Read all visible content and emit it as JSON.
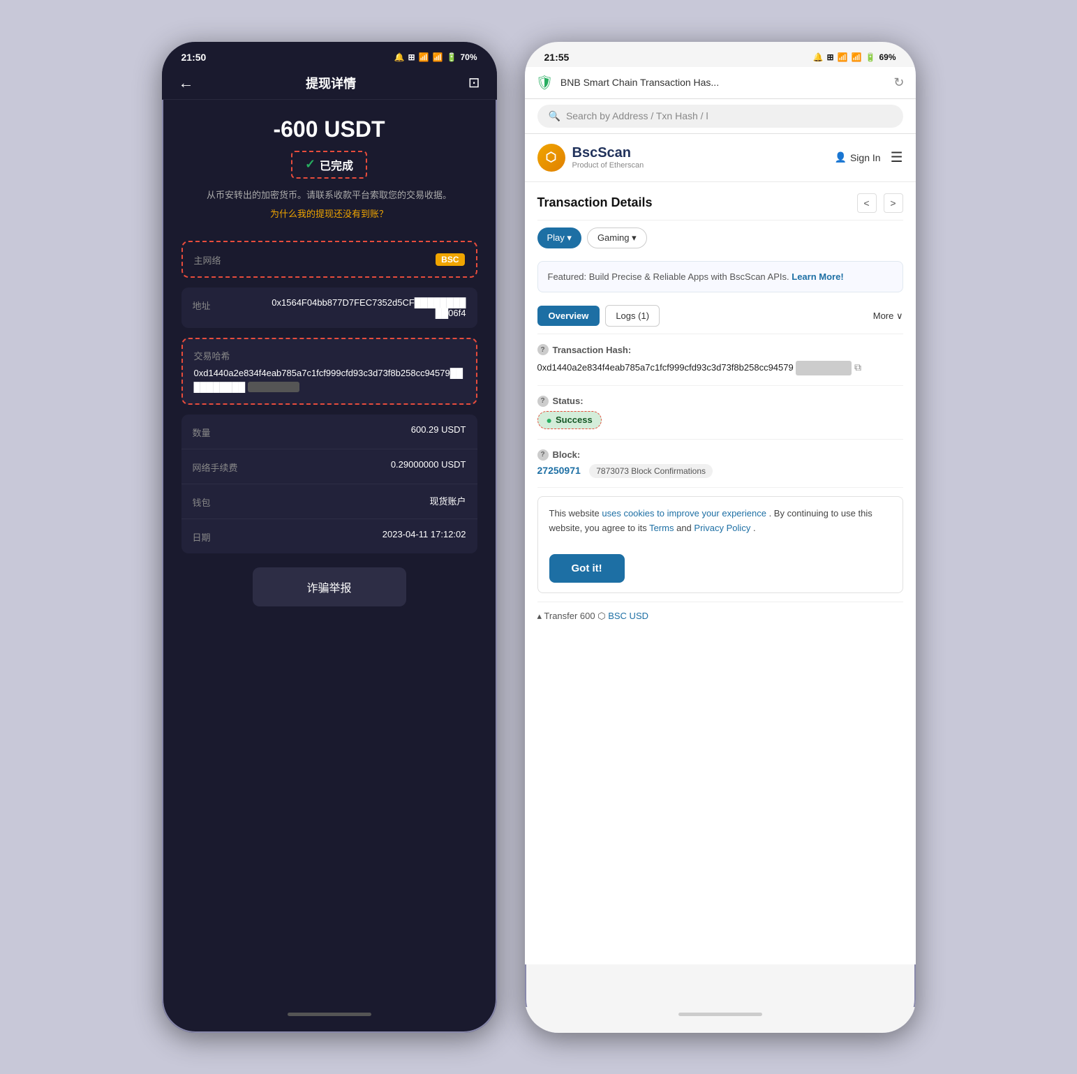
{
  "left_phone": {
    "status_bar": {
      "time": "21:50",
      "icons": "🔔 🎧 📷 📶 📶 🔋70%"
    },
    "nav": {
      "title": "提现详情",
      "back": "←",
      "icon": "?"
    },
    "amount": "-600 USDT",
    "completed_label": "已完成",
    "desc": "从币安转出的加密货币。请联系收款平台索取您的交易收据。",
    "why_link": "为什么我的提现还没有到账？",
    "network_label": "主网络",
    "network_value": "BSC",
    "address_label": "地址",
    "address_value": "0x1564F04bb877D7FEC7352d5CF██████████06f4",
    "txhash_label": "交易哈希",
    "txhash_value": "0xd1440a2e834f4eab785a7c1fcf999cfd93c3d73f8b258cc94579██████████",
    "quantity_label": "数量",
    "quantity_value": "600.29 USDT",
    "fee_label": "网络手续费",
    "fee_value": "0.29000000 USDT",
    "wallet_label": "钱包",
    "wallet_value": "现货账户",
    "date_label": "日期",
    "date_value": "2023-04-11 17:12:02",
    "report_btn": "诈骗举报"
  },
  "right_phone": {
    "status_bar": {
      "time": "21:55",
      "icons": "🔔 🎧 📷 📶 📶 🔋69%"
    },
    "browser_url": "BNB Smart Chain Transaction Has...",
    "search_placeholder": "Search by Address / Txn Hash / l",
    "logo_text": "BscScan",
    "logo_sub": "Product of Etherscan",
    "sign_in": "Sign In",
    "page_title": "Transaction Details",
    "pills": [
      "Play ▾",
      "Gaming ▾"
    ],
    "featured_text": "Featured: Build Precise & Reliable Apps with BscScan APIs.",
    "learn_more": "Learn More!",
    "tab_overview": "Overview",
    "tab_logs": "Logs (1)",
    "tab_more": "More ∨",
    "txhash_label": "Transaction Hash:",
    "txhash_value": "0xd1440a2e834f4eab785a7c1fcf999cfd93c3d73f8b258cc94579",
    "txhash_blurred": "██████████",
    "status_label": "Status:",
    "status_value": "Success",
    "block_label": "Block:",
    "block_number": "27250971",
    "block_confirmations": "7873073 Block Confirmations",
    "cookie_text1": "This website ",
    "cookie_link1": "uses cookies to improve your experience",
    "cookie_text2": ". By continuing to use this website, you agree to its ",
    "cookie_link2": "Terms",
    "cookie_text3": " and ",
    "cookie_link3": "Privacy Policy",
    "cookie_text4": ".",
    "got_it": "Got it!",
    "transfer_label": "▴ Transfer 600",
    "transfer_link": "BSC USD"
  }
}
